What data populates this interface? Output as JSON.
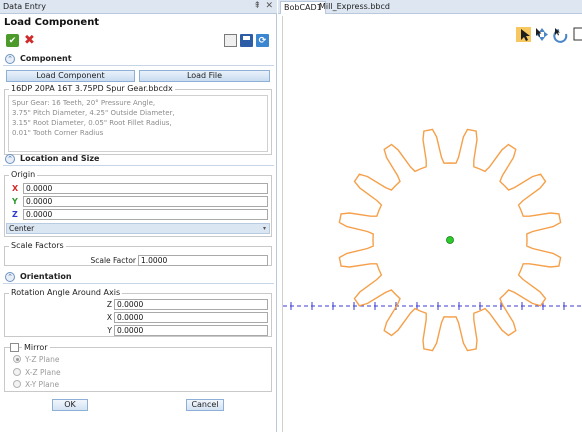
{
  "panel": {
    "title": "Data Entry",
    "pin_glyph": "⇞",
    "close_glyph": "✕",
    "heading": "Load Component"
  },
  "component": {
    "section_label": "Component",
    "load_component_label": "Load Component",
    "load_file_label": "Load File",
    "file_legend": "16DP 20PA 16T 3.75PD Spur Gear.bbcdx",
    "description_lines": [
      "Spur Gear: 16 Teeth, 20° Pressure Angle,",
      "3.75\" Pitch Diameter, 4.25\" Outside Diameter,",
      "3.15\" Root Diameter, 0.05\" Root Fillet Radius,",
      "0.01\" Tooth Corner Radius"
    ]
  },
  "location": {
    "section_label": "Location and Size",
    "origin_legend": "Origin",
    "x_label": "X",
    "y_label": "Y",
    "z_label": "Z",
    "x_value": "0.0000",
    "y_value": "0.0000",
    "z_value": "0.0000",
    "anchor_selected": "Center",
    "scale_legend": "Scale Factors",
    "scale_label": "Scale Factor",
    "scale_value": "1.0000"
  },
  "orientation": {
    "section_label": "Orientation",
    "rotation_legend": "Rotation Angle Around Axis",
    "z_label": "Z",
    "x_label": "X",
    "y_label": "Y",
    "z_value": "0.0000",
    "x_value": "0.0000",
    "y_value": "0.0000"
  },
  "mirror": {
    "label": "Mirror",
    "options": [
      "Y-Z Plane",
      "X-Z Plane",
      "X-Y Plane"
    ]
  },
  "actions": {
    "ok_label": "OK",
    "cancel_label": "Cancel"
  },
  "tabs": [
    "BobCAD1",
    "Mill_Express.bbcd"
  ],
  "gear": {
    "teeth": 16,
    "stroke_color": "#f5a04a",
    "center_color": "#2dcc2d",
    "axis_color": "#3b3bd6"
  },
  "colors": {
    "select_tool_bg": "#f7c760"
  }
}
